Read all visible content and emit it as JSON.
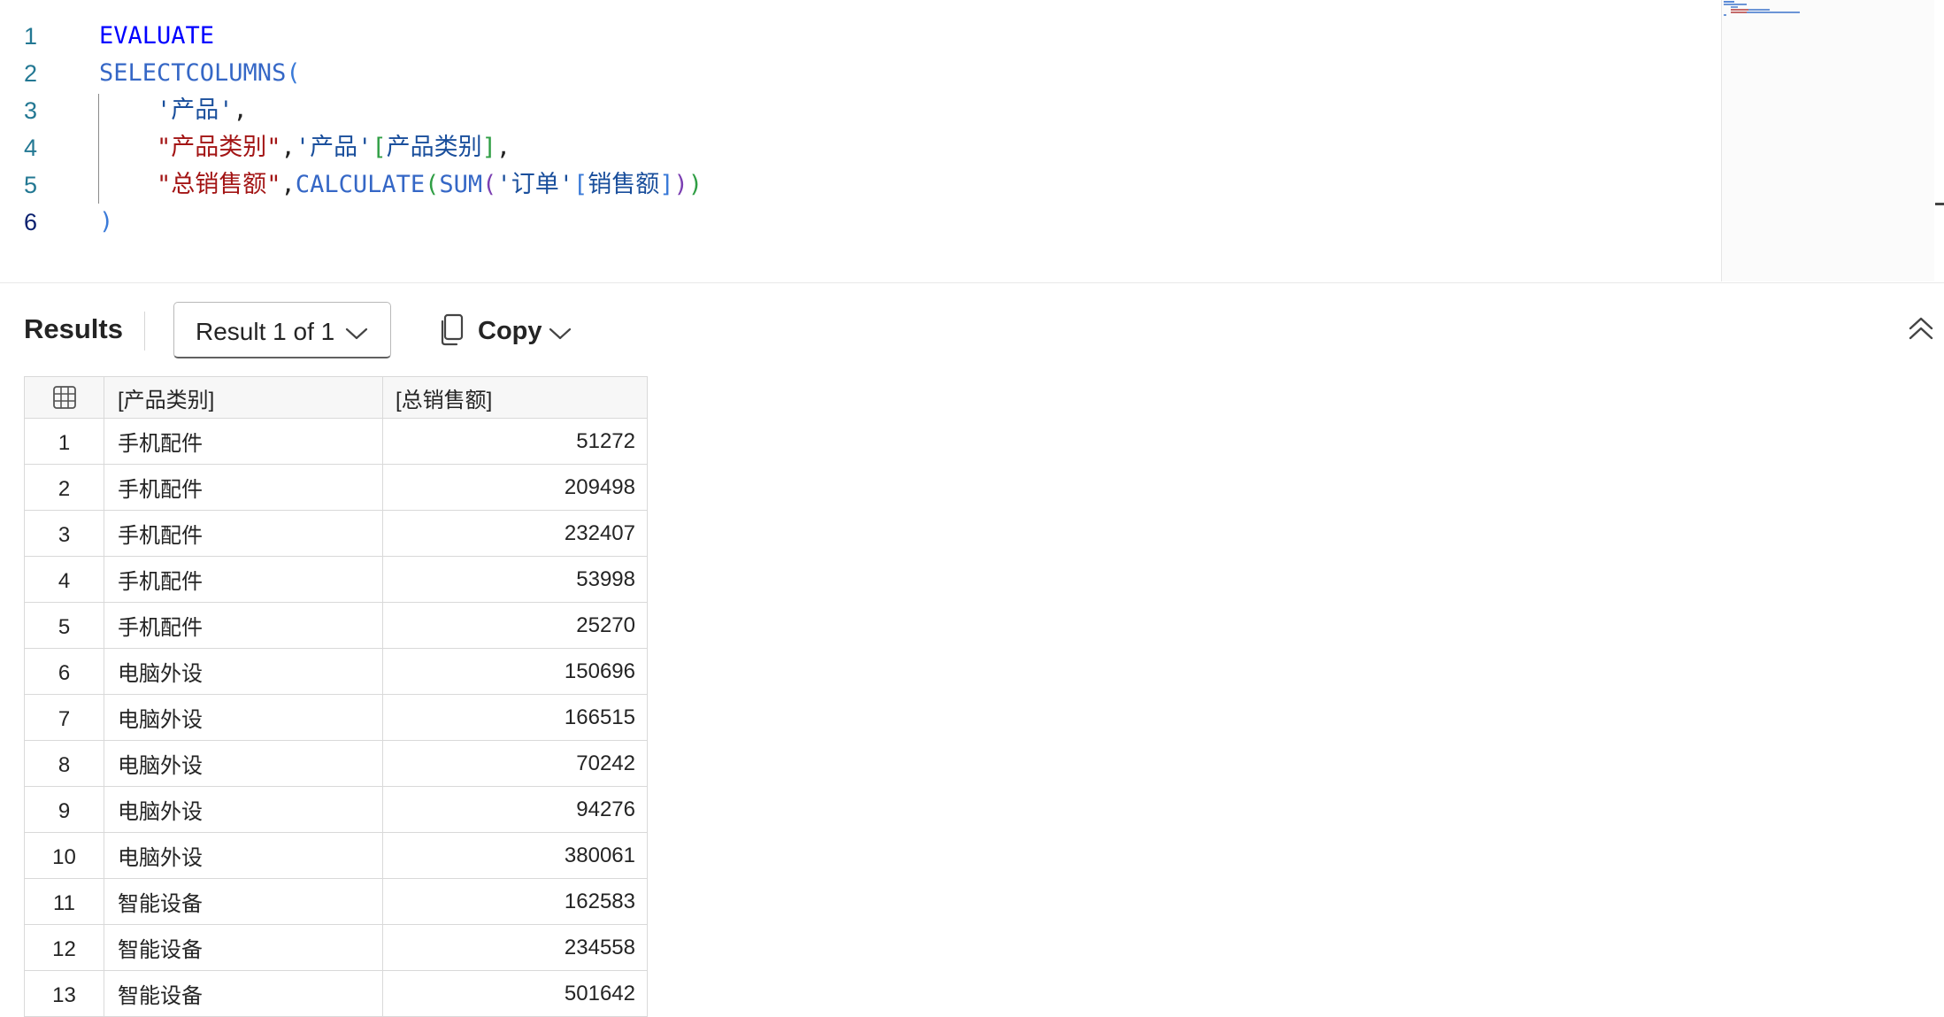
{
  "editor": {
    "lines": [
      {
        "n": "1",
        "tokens": [
          {
            "t": "EVALUATE",
            "c": "kw"
          }
        ]
      },
      {
        "n": "2",
        "tokens": [
          {
            "t": "SELECTCOLUMNS",
            "c": "fn"
          },
          {
            "t": "(",
            "c": "b1"
          }
        ]
      },
      {
        "n": "3",
        "tokens": [
          {
            "t": "    ",
            "c": "pun"
          },
          {
            "t": "'产品'",
            "c": "tbl"
          },
          {
            "t": ",",
            "c": "pun"
          }
        ]
      },
      {
        "n": "4",
        "tokens": [
          {
            "t": "    ",
            "c": "pun"
          },
          {
            "t": "\"产品类别\"",
            "c": "str"
          },
          {
            "t": ",",
            "c": "pun"
          },
          {
            "t": "'产品'",
            "c": "tbl"
          },
          {
            "t": "[",
            "c": "b2"
          },
          {
            "t": "产品类别",
            "c": "tbl"
          },
          {
            "t": "]",
            "c": "b2"
          },
          {
            "t": ",",
            "c": "pun"
          }
        ]
      },
      {
        "n": "5",
        "tokens": [
          {
            "t": "    ",
            "c": "pun"
          },
          {
            "t": "\"总销售额\"",
            "c": "str"
          },
          {
            "t": ",",
            "c": "pun"
          },
          {
            "t": "CALCULATE",
            "c": "fn"
          },
          {
            "t": "(",
            "c": "b2"
          },
          {
            "t": "SUM",
            "c": "fn"
          },
          {
            "t": "(",
            "c": "b3"
          },
          {
            "t": "'订单'",
            "c": "tbl"
          },
          {
            "t": "[",
            "c": "b1"
          },
          {
            "t": "销售额",
            "c": "tbl"
          },
          {
            "t": "]",
            "c": "b1"
          },
          {
            "t": ")",
            "c": "b3"
          },
          {
            "t": ")",
            "c": "b2"
          }
        ]
      },
      {
        "n": "6",
        "tokens": [
          {
            "t": ")",
            "c": "b1"
          }
        ]
      }
    ],
    "active_line": "6",
    "minimap_icon": "minimap-preview"
  },
  "results": {
    "title": "Results",
    "result_selector": "Result 1 of 1",
    "copy_label": "Copy",
    "icons": {
      "dropdown": "chevron-down-icon",
      "copy": "copy-icon",
      "collapse": "double-chevron-up-icon",
      "grid": "table-grid-icon"
    },
    "columns": [
      "[产品类别]",
      "[总销售额]"
    ],
    "rows": [
      {
        "n": "1",
        "category": "手机配件",
        "sales": "51272"
      },
      {
        "n": "2",
        "category": "手机配件",
        "sales": "209498"
      },
      {
        "n": "3",
        "category": "手机配件",
        "sales": "232407"
      },
      {
        "n": "4",
        "category": "手机配件",
        "sales": "53998"
      },
      {
        "n": "5",
        "category": "手机配件",
        "sales": "25270"
      },
      {
        "n": "6",
        "category": "电脑外设",
        "sales": "150696"
      },
      {
        "n": "7",
        "category": "电脑外设",
        "sales": "166515"
      },
      {
        "n": "8",
        "category": "电脑外设",
        "sales": "70242"
      },
      {
        "n": "9",
        "category": "电脑外设",
        "sales": "94276"
      },
      {
        "n": "10",
        "category": "电脑外设",
        "sales": "380061"
      },
      {
        "n": "11",
        "category": "智能设备",
        "sales": "162583"
      },
      {
        "n": "12",
        "category": "智能设备",
        "sales": "234558"
      },
      {
        "n": "13",
        "category": "智能设备",
        "sales": "501642"
      }
    ]
  }
}
